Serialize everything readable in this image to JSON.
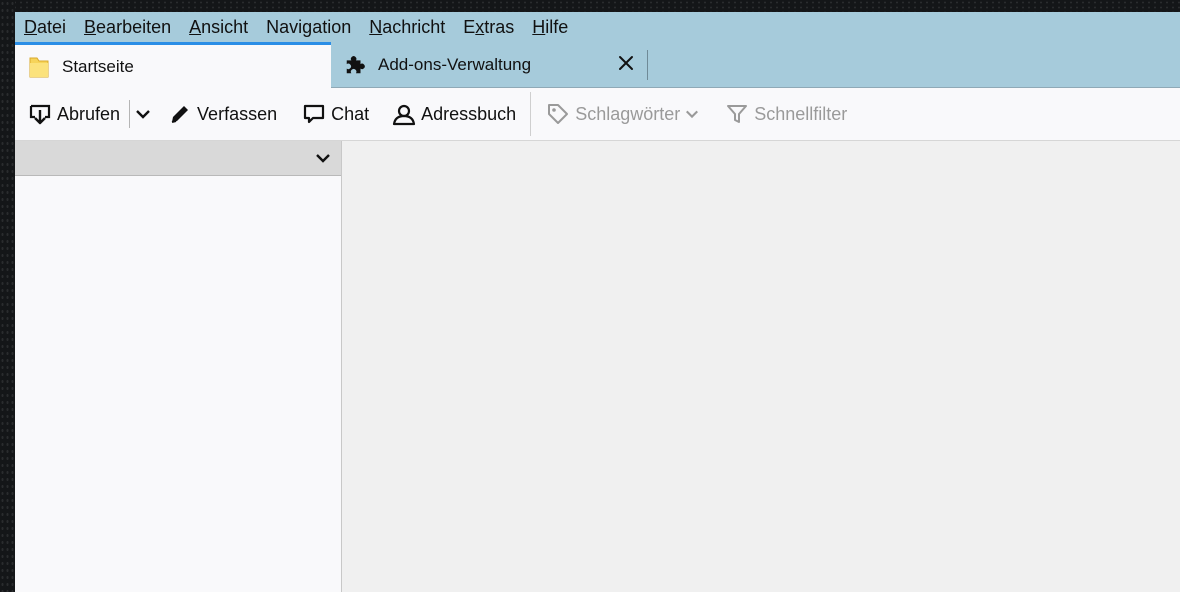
{
  "menubar": {
    "items": [
      {
        "label": "Datei",
        "accel": "D",
        "rest": "atei"
      },
      {
        "label": "Bearbeiten",
        "accel": "B",
        "rest": "earbeiten"
      },
      {
        "label": "Ansicht",
        "accel": "A",
        "rest": "nsicht"
      },
      {
        "label": "Navigation",
        "pre": "Navi",
        "accel": "g",
        "rest": "ation"
      },
      {
        "label": "Nachricht",
        "accel": "N",
        "rest": "achricht"
      },
      {
        "label": "Extras",
        "pre": "E",
        "accel": "x",
        "rest": "tras"
      },
      {
        "label": "Hilfe",
        "accel": "H",
        "rest": "ilfe"
      }
    ]
  },
  "tabs": {
    "active": {
      "label": "Startseite",
      "icon": "folder-icon"
    },
    "inactive": {
      "label": "Add-ons-Verwaltung",
      "icon": "puzzle-icon"
    },
    "close_icon": "close-icon"
  },
  "toolbar": {
    "get_messages": "Abrufen",
    "compose": "Verfassen",
    "chat": "Chat",
    "address_book": "Adressbuch",
    "tags": "Schlagwörter",
    "quick_filter": "Schnellfilter"
  },
  "colors": {
    "menubar_bg": "#a6cbdb",
    "active_tab_accent": "#2b8ee6",
    "disabled_text": "#9a9a9a"
  }
}
